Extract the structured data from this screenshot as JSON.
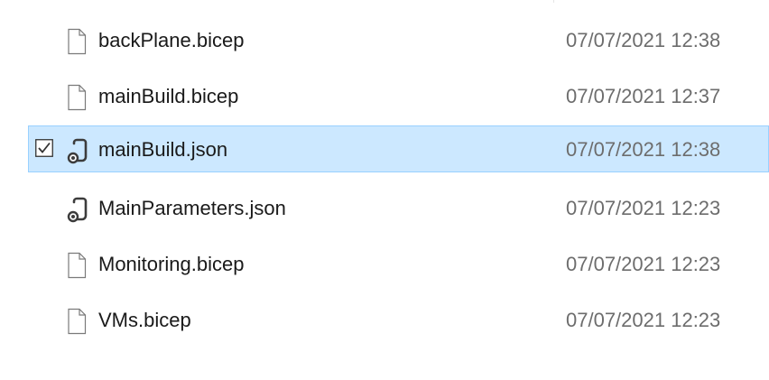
{
  "files": [
    {
      "name": "backPlane.bicep",
      "date_modified": "07/07/2021 12:38",
      "icon": "blank-file-icon",
      "selected": false
    },
    {
      "name": "mainBuild.bicep",
      "date_modified": "07/07/2021 12:37",
      "icon": "blank-file-icon",
      "selected": false
    },
    {
      "name": "mainBuild.json",
      "date_modified": "07/07/2021 12:38",
      "icon": "json-file-icon",
      "selected": true
    },
    {
      "name": "MainParameters.json",
      "date_modified": "07/07/2021 12:23",
      "icon": "json-file-icon",
      "selected": false
    },
    {
      "name": "Monitoring.bicep",
      "date_modified": "07/07/2021 12:23",
      "icon": "blank-file-icon",
      "selected": false
    },
    {
      "name": "VMs.bicep",
      "date_modified": "07/07/2021 12:23",
      "icon": "blank-file-icon",
      "selected": false
    }
  ],
  "colors": {
    "selection_background": "#cce8ff",
    "selection_border": "#99d1ff",
    "name_text": "#1a1a1a",
    "date_text": "#6d6d6d"
  }
}
